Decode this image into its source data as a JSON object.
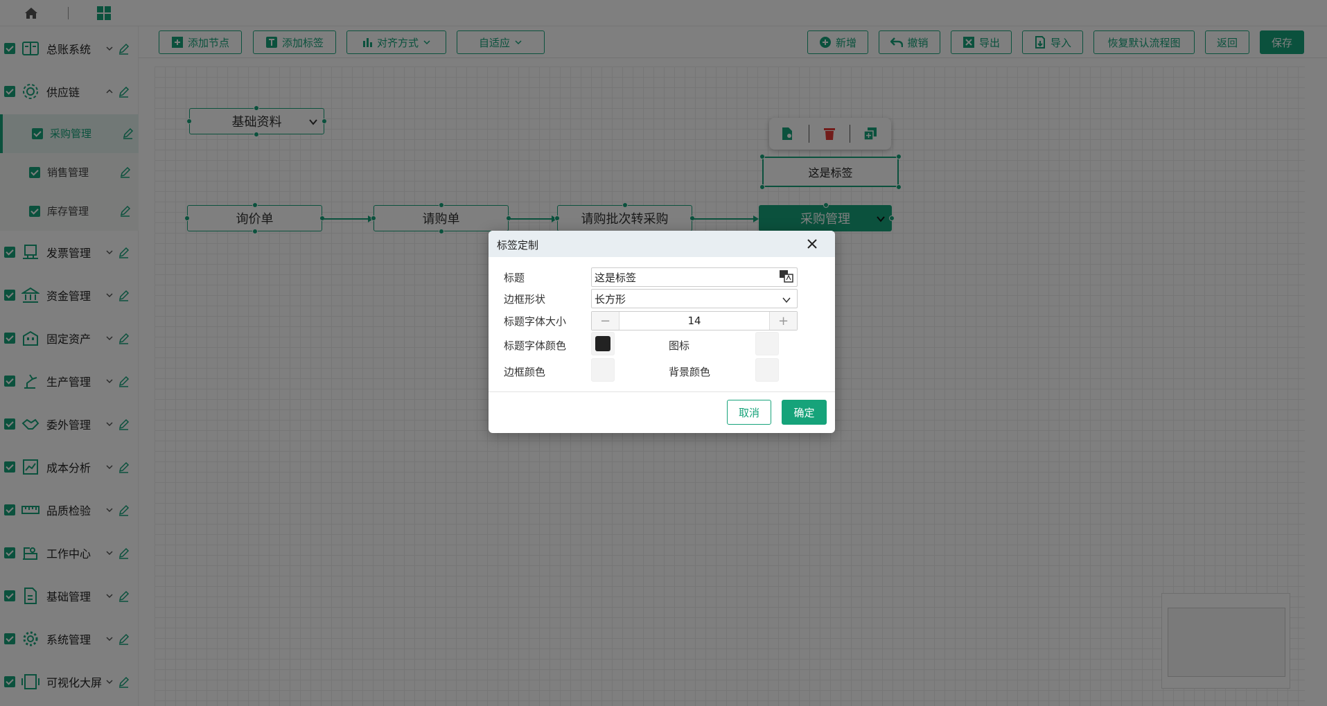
{
  "theme": {
    "accent": "#16a37a",
    "overlay": "rgba(0,0,0,0.5)"
  },
  "topbar": {
    "icons": [
      "home-icon",
      "apps-grid-icon"
    ]
  },
  "sidebar": {
    "items": [
      {
        "label": "总账系统",
        "icon": "ledger-icon",
        "expanded": false
      },
      {
        "label": "供应链",
        "icon": "gear-icon",
        "expanded": true,
        "children": [
          {
            "label": "采购管理",
            "active": true
          },
          {
            "label": "销售管理",
            "active": false
          },
          {
            "label": "库存管理",
            "active": false
          }
        ]
      },
      {
        "label": "发票管理",
        "icon": "invoice-icon",
        "expanded": false
      },
      {
        "label": "资金管理",
        "icon": "bank-icon",
        "expanded": false
      },
      {
        "label": "固定资产",
        "icon": "building-icon",
        "expanded": false
      },
      {
        "label": "生产管理",
        "icon": "robot-arm-icon",
        "expanded": false
      },
      {
        "label": "委外管理",
        "icon": "handshake-icon",
        "expanded": false
      },
      {
        "label": "成本分析",
        "icon": "line-chart-icon",
        "expanded": false
      },
      {
        "label": "品质检验",
        "icon": "ruler-icon",
        "expanded": false
      },
      {
        "label": "工作中心",
        "icon": "workstation-icon",
        "expanded": false
      },
      {
        "label": "基础管理",
        "icon": "document-icon",
        "expanded": false
      },
      {
        "label": "系统管理",
        "icon": "settings-icon",
        "expanded": false
      },
      {
        "label": "可视化大屏",
        "icon": "screen-icon",
        "expanded": false
      }
    ]
  },
  "toolbar": {
    "add_node": "添加节点",
    "add_label": "添加标签",
    "align": "对齐方式",
    "fit": "自适应",
    "add": "新增",
    "undo": "撤销",
    "export": "导出",
    "import": "导入",
    "restore": "恢复默认流程图",
    "back": "返回",
    "save": "保存"
  },
  "canvas": {
    "group_node": "基础资料",
    "nodes": [
      "询价单",
      "请购单",
      "请购批次转采购",
      "采购管理"
    ],
    "selected_node": "采购管理",
    "label_box": "这是标签"
  },
  "dialog": {
    "title": "标签定制",
    "fields": {
      "title_label": "标题",
      "title_value": "这是标签",
      "shape_label": "边框形状",
      "shape_value": "长方形",
      "font_size_label": "标题字体大小",
      "font_size_value": "14",
      "font_color_label": "标题字体颜色",
      "font_color": "#222222",
      "icon_label": "图标",
      "border_color_label": "边框颜色",
      "bg_color_label": "背景颜色"
    },
    "cancel": "取消",
    "ok": "确定"
  }
}
